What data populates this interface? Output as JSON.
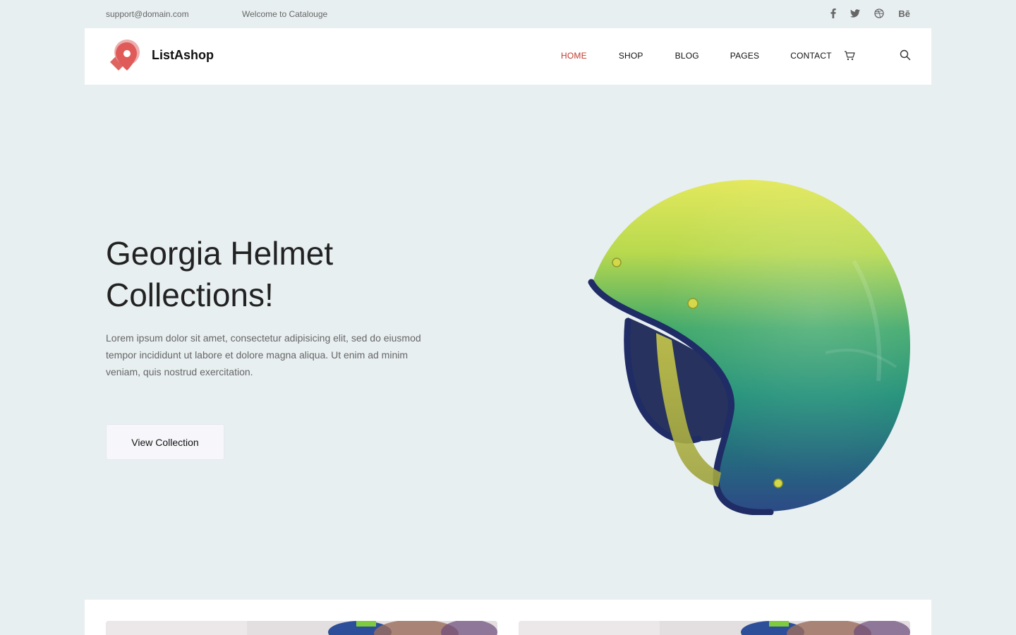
{
  "topbar": {
    "email": "support@domain.com",
    "welcome": "Welcome to Catalouge",
    "socials": [
      "facebook-icon",
      "twitter-icon",
      "dribbble-icon",
      "behance-icon"
    ],
    "behance_label": "Bē"
  },
  "header": {
    "brand": "ListAshop",
    "nav": [
      {
        "label": "HOME",
        "active": true
      },
      {
        "label": "SHOP",
        "active": false
      },
      {
        "label": "BLOG",
        "active": false
      },
      {
        "label": "PAGES",
        "active": false
      },
      {
        "label": "CONTACT",
        "active": false
      }
    ],
    "icons": [
      "cart-icon",
      "search-icon"
    ]
  },
  "hero": {
    "title_line1": "Georgia Helmet",
    "title_line2": "Collections!",
    "desc_line1": "Lorem ipsum dolor sit amet, consectetur adipisicing elit, sed do eiusmod",
    "desc_line2": "tempor incididunt ut labore et dolore magna aliqua. Ut enim ad minim",
    "desc_line3": "veniam, quis nostrud exercitation.",
    "button": "View Collection"
  },
  "colors": {
    "accent": "#c0392b",
    "background": "#e8eff1",
    "logo": "#e05a5a"
  }
}
